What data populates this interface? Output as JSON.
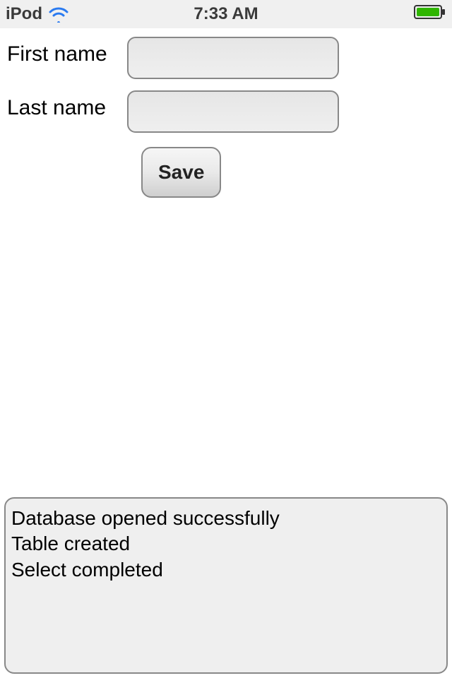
{
  "status_bar": {
    "device": "iPod",
    "time": "7:33 AM",
    "wifi_color": "#2a7af0",
    "battery_fill": "#2fb500",
    "battery_outline": "#333333"
  },
  "form": {
    "first_name": {
      "label": "First name",
      "value": "",
      "placeholder": ""
    },
    "last_name": {
      "label": "Last name",
      "value": "",
      "placeholder": ""
    },
    "save_label": "Save"
  },
  "log": {
    "lines": [
      "Database opened successfully",
      "Table created",
      "Select completed"
    ]
  }
}
